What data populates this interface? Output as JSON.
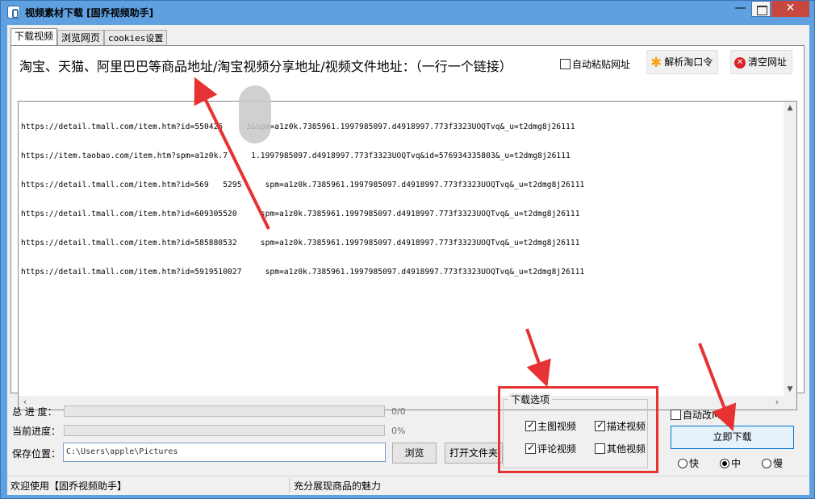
{
  "window": {
    "title": "视频素材下载 [固乔视频助手]"
  },
  "tabs": [
    {
      "label": "下载视频"
    },
    {
      "label": "浏览网页"
    },
    {
      "label": "cookies设置"
    }
  ],
  "main": {
    "heading": "淘宝、天猫、阿里巴巴等商品地址/淘宝视频分享地址/视频文件地址：（一行一个链接）",
    "auto_paste_label": "自动粘贴网址",
    "auto_paste_checked": false,
    "parse_button": "解析淘口令",
    "parse_icon": "star-icon",
    "clear_button": "清空网址",
    "clear_icon": "delete-icon",
    "urls": [
      "https://detail.tmall.com/item.htm?id=550426     3&spm=a1z0k.7385961.1997985097.d4918997.773f3323UOQTvq&_u=t2dmg8j26111",
      "https://item.taobao.com/item.htm?spm=a1z0k.7     1.1997985097.d4918997.773f3323UOQTvq&id=576934335803&_u=t2dmg8j26111",
      "https://detail.tmall.com/item.htm?id=569   5295     spm=a1z0k.7385961.1997985097.d4918997.773f3323UOQTvq&_u=t2dmg8j26111",
      "https://detail.tmall.com/item.htm?id=609305520     spm=a1z0k.7385961.1997985097.d4918997.773f3323UOQTvq&_u=t2dmg8j26111",
      "https://detail.tmall.com/item.htm?id=585880532     spm=a1z0k.7385961.1997985097.d4918997.773f3323UOQTvq&_u=t2dmg8j26111",
      "https://detail.tmall.com/item.htm?id=5919510027     spm=a1z0k.7385961.1997985097.d4918997.773f3323UOQTvq&_u=t2dmg8j26111"
    ]
  },
  "progress": {
    "total_label": "总 进 度：",
    "total_value": "0/0",
    "total_fraction": 0,
    "current_label": "当前进度：",
    "current_value": "0%",
    "current_fraction": 0
  },
  "save": {
    "label": "保存位置：",
    "path": "C:\\Users\\apple\\Pictures",
    "browse_button": "浏览",
    "open_folder_button": "打开文件夹"
  },
  "download_options": {
    "title": "下载选项",
    "items": [
      {
        "label": "主图视频",
        "checked": true
      },
      {
        "label": "描述视频",
        "checked": true
      },
      {
        "label": "评论视频",
        "checked": true
      },
      {
        "label": "其他视频",
        "checked": false
      }
    ]
  },
  "actions": {
    "auto_rename_label": "自动改MD5",
    "auto_rename_checked": false,
    "download_button": "立即下载",
    "speed_options": [
      {
        "label": "快",
        "checked": false
      },
      {
        "label": "中",
        "checked": true
      },
      {
        "label": "慢",
        "checked": false
      }
    ]
  },
  "status": {
    "left": "欢迎使用【固乔视频助手】",
    "right": "充分展现商品的魅力"
  },
  "colors": {
    "title_bar": "#5fa0e0",
    "annotation": "#e63232",
    "close_button": "#c7463d"
  }
}
